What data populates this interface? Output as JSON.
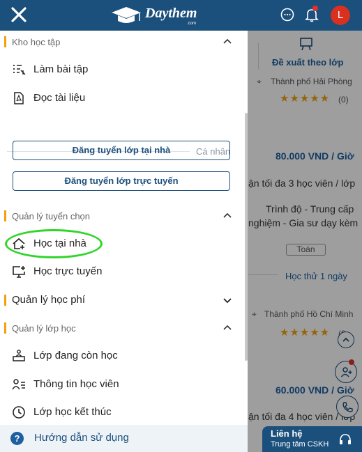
{
  "header": {
    "logo_text": "Daythem",
    "logo_sub": ".com",
    "avatar_letter": "L",
    "brand_color": "#1b4f7c"
  },
  "background": {
    "tab_label": "Đề xuất theo lớp",
    "card1": {
      "location": "Thành phố Hải Phòng",
      "stars": "★★★★★",
      "rating_count": "(0)",
      "price": "80.000 VND / Giờ",
      "capacity": "ận tối đa 3 học viên / lớp",
      "level": "Trình độ - Trung cấp",
      "experience": "nghiệm - Gia sư dạy kèm",
      "subject": "Toán",
      "trial": "Học thử 1 ngày"
    },
    "card2": {
      "location": "Thành phố Hồ Chí Minh",
      "stars": "★★★★★",
      "rating_count": "(0",
      "price": "60.000 VND / Giờ",
      "capacity": "ận tối đa 4 học viên / lớp"
    },
    "contact": {
      "title": "Liên hệ",
      "subtitle": "Trung tâm CSKH"
    }
  },
  "drawer": {
    "sections": {
      "study": "Kho học tập",
      "selection": "Quản lý tuyển chọn",
      "fees": "Quản lý học phí",
      "classes": "Quản lý lớp học"
    },
    "items": {
      "do_exercises": "Làm bài tập",
      "read_docs": "Đọc tài liệu",
      "home_study": "Học tại nhà",
      "online_study": "Học trực tuyến",
      "ongoing": "Lớp đang còn học",
      "students": "Thông tin học viên",
      "finished": "Lớp học kết thúc"
    },
    "personal_label": "Cá nhân",
    "buttons": {
      "home_post": "Đăng tuyển lớp tại nhà",
      "online_post": "Đăng tuyển lớp trực tuyến"
    },
    "footer_label": "Hướng dẫn sử dụng"
  },
  "colors": {
    "accent": "#f2a10d",
    "highlight": "#2fd62a",
    "star": "#f2a10d"
  }
}
